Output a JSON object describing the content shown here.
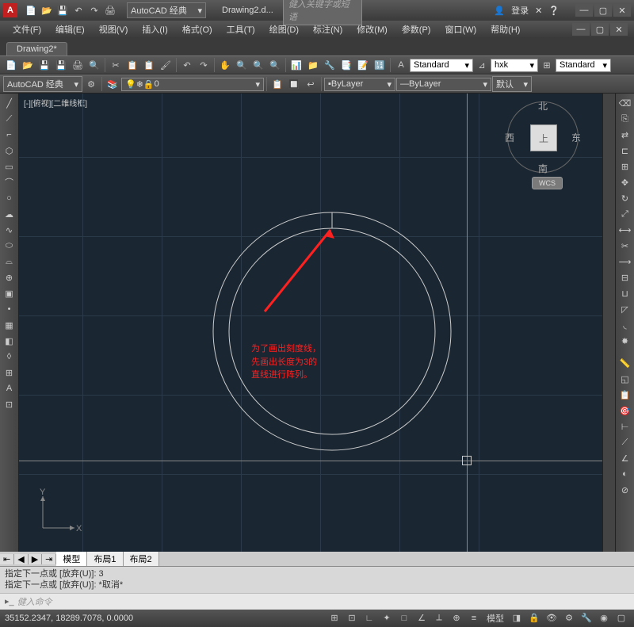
{
  "title": {
    "doc": "Drawing2.d...",
    "search_ph": "健入关键字或短语",
    "login": "登录"
  },
  "workspace": "AutoCAD 经典",
  "menus": [
    "文件(F)",
    "编辑(E)",
    "视图(V)",
    "插入(I)",
    "格式(O)",
    "工具(T)",
    "绘图(D)",
    "标注(N)",
    "修改(M)",
    "参数(P)",
    "窗口(W)",
    "帮助(H)"
  ],
  "doctab": "Drawing2*",
  "props": {
    "ws": "AutoCAD 经典",
    "layer": "0",
    "style1": "Standard",
    "style2": "hxk",
    "style3": "Standard",
    "bylayer": "ByLayer",
    "bylayer2": "ByLayer",
    "color_label": "默认"
  },
  "viewport": {
    "label": "[-][俯视][二维线框]",
    "compass": {
      "n": "北",
      "s": "南",
      "e": "东",
      "w": "西",
      "top": "上"
    },
    "wcs": "WCS"
  },
  "annotation": {
    "line1": "为了画出刻度线，",
    "line2": "先画出长度为3的",
    "line3": "直线进行阵列。"
  },
  "layout_tabs": [
    "模型",
    "布局1",
    "布局2"
  ],
  "cmd": {
    "hist1": "指定下一点或 [放弃(U)]:  3",
    "hist2": "指定下一点或 [放弃(U)]:  *取消*",
    "prompt": "健入命令"
  },
  "status": {
    "coords": "35152.2347, 18289.7078, 0.0000",
    "model": "模型"
  },
  "ucs": {
    "x": "X",
    "y": "Y"
  }
}
